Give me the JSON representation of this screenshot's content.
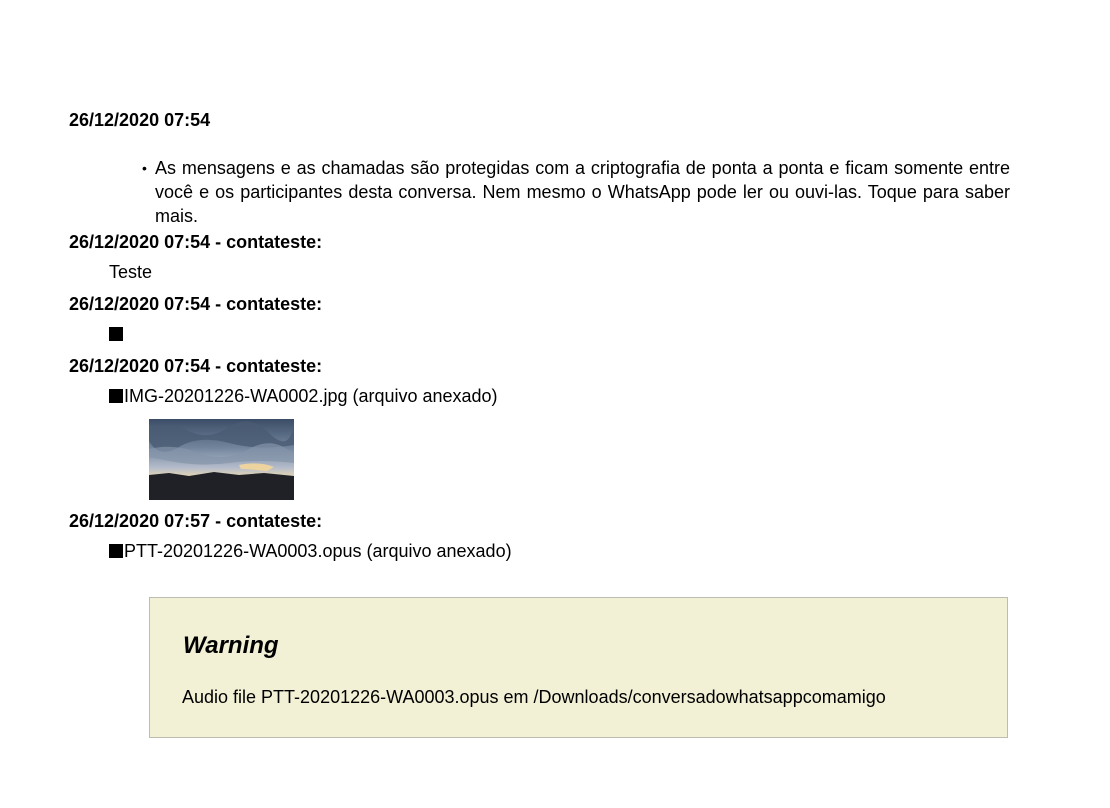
{
  "system_entry": {
    "timestamp": "26/12/2020 07:54",
    "bullet": "•",
    "text": "As mensagens e as chamadas são protegidas com a criptografia de ponta a ponta e ficam somente entre você e os participantes desta conversa. Nem mesmo o WhatsApp pode ler ou ouvi-las. Toque para saber mais."
  },
  "messages": [
    {
      "header": "26/12/2020 07:54 - contateste:",
      "body": "Teste"
    },
    {
      "header": "26/12/2020 07:54 - contateste:",
      "body": ""
    },
    {
      "header": "26/12/2020 07:54 - contateste:",
      "body": "IMG-20201226-WA0002.jpg (arquivo anexado)"
    },
    {
      "header": "26/12/2020 07:57 - contateste:",
      "body": "PTT-20201226-WA0003.opus (arquivo anexado)"
    }
  ],
  "warning": {
    "title": "Warning",
    "text": "Audio file PTT-20201226-WA0003.opus em /Downloads/conversadowhatsappcomamigo"
  },
  "colors": {
    "warning_background": "#f2f1d5",
    "warning_border": "#bcbcb0",
    "text": "#000000"
  },
  "icons": {
    "attachment_marker": "black-square-glyph",
    "thumbnail": "landscape-photo-cloudy-sky-sunset"
  }
}
